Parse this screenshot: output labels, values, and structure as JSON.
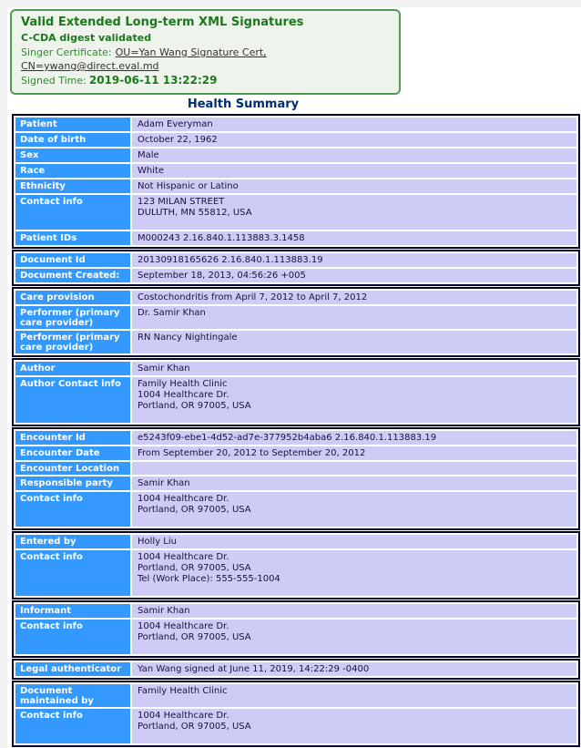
{
  "banner": {
    "title": "Valid Extended Long-term XML Signatures",
    "digest_status": "C-CDA digest validated",
    "certificate_label": "Singer Certificate:",
    "certificate_link": "OU=Yan Wang Signature Cert, CN=ywang@direct.eval.md",
    "signed_time_label": "Signed Time:",
    "signed_time_value": "2019-06-11 13:22:29"
  },
  "page_title": "Health Summary",
  "colors": {
    "banner_border": "#4f9d52",
    "banner_bg": "#eef3ec",
    "banner_heading": "#1a7a1a",
    "banner_text": "#2e8b2e",
    "title_color": "#002d72",
    "label_bg": "#3399ff",
    "value_bg": "#ccccf7",
    "table_border": "#000033",
    "value_text": "#14143c"
  },
  "table_groups": [
    {
      "rows": [
        {
          "label": "Patient",
          "value_lines": [
            "Adam Everyman"
          ]
        },
        {
          "label": "Date of birth",
          "value_lines": [
            "October 22, 1962"
          ]
        },
        {
          "label": "Sex",
          "value_lines": [
            "Male"
          ]
        },
        {
          "label": "Race",
          "value_lines": [
            "White"
          ]
        },
        {
          "label": "Ethnicity",
          "value_lines": [
            "Not Hispanic or Latino"
          ]
        },
        {
          "label": "Contact info",
          "value_lines": [
            "123 MILAN STREET",
            "DULUTH, MN 55812, USA"
          ]
        },
        {
          "label": "Patient IDs",
          "value_lines": [
            "M000243 2.16.840.1.113883.3.1458"
          ]
        }
      ]
    },
    {
      "rows": [
        {
          "label": "Document Id",
          "value_lines": [
            "20130918165626 2.16.840.1.113883.19"
          ]
        },
        {
          "label": "Document Created:",
          "value_lines": [
            "September 18, 2013, 04:56:26 +005"
          ]
        }
      ]
    },
    {
      "rows": [
        {
          "label": "Care provision",
          "value_lines": [
            "Costochondritis from April 7, 2012 to April 7, 2012"
          ]
        },
        {
          "label": "Performer (primary care provider)",
          "value_lines": [
            "Dr. Samir Khan"
          ]
        },
        {
          "label": "Performer (primary care provider)",
          "value_lines": [
            "RN Nancy Nightingale"
          ]
        }
      ]
    },
    {
      "rows": [
        {
          "label": "Author",
          "value_lines": [
            "Samir Khan"
          ]
        },
        {
          "label": "Author Contact info",
          "value_lines": [
            "Family Health Clinic",
            "1004 Healthcare Dr.",
            "Portland, OR 97005, USA"
          ]
        }
      ]
    },
    {
      "rows": [
        {
          "label": "Encounter Id",
          "value_lines": [
            "e5243f09-ebe1-4d52-ad7e-377952b4aba6 2.16.840.1.113883.19"
          ]
        },
        {
          "label": "Encounter Date",
          "value_lines": [
            "From September 20, 2012 to September 20, 2012"
          ]
        },
        {
          "label": "Encounter Location",
          "value_lines": []
        },
        {
          "label": "Responsible party",
          "value_lines": [
            "Samir Khan"
          ]
        },
        {
          "label": "Contact info",
          "value_lines": [
            "1004 Healthcare Dr.",
            "Portland, OR 97005, USA"
          ]
        }
      ]
    },
    {
      "rows": [
        {
          "label": "Entered by",
          "value_lines": [
            "Holly Liu"
          ]
        },
        {
          "label": "Contact info",
          "value_lines": [
            "1004 Healthcare Dr.",
            "Portland, OR 97005, USA",
            "Tel (Work Place): 555-555-1004"
          ]
        }
      ]
    },
    {
      "rows": [
        {
          "label": "Informant",
          "value_lines": [
            "Samir Khan"
          ]
        },
        {
          "label": "Contact info",
          "value_lines": [
            "1004 Healthcare Dr.",
            "Portland, OR 97005, USA"
          ]
        }
      ]
    },
    {
      "rows": [
        {
          "label": "Legal authenticator",
          "value_lines": [
            "Yan Wang signed at June 11, 2019, 14:22:29 -0400"
          ]
        }
      ]
    },
    {
      "rows": [
        {
          "label": "Document maintained by",
          "value_lines": [
            "Family Health Clinic"
          ]
        },
        {
          "label": "Contact info",
          "value_lines": [
            "1004 Healthcare Dr.",
            "Portland, OR 97005, USA"
          ]
        }
      ]
    }
  ]
}
